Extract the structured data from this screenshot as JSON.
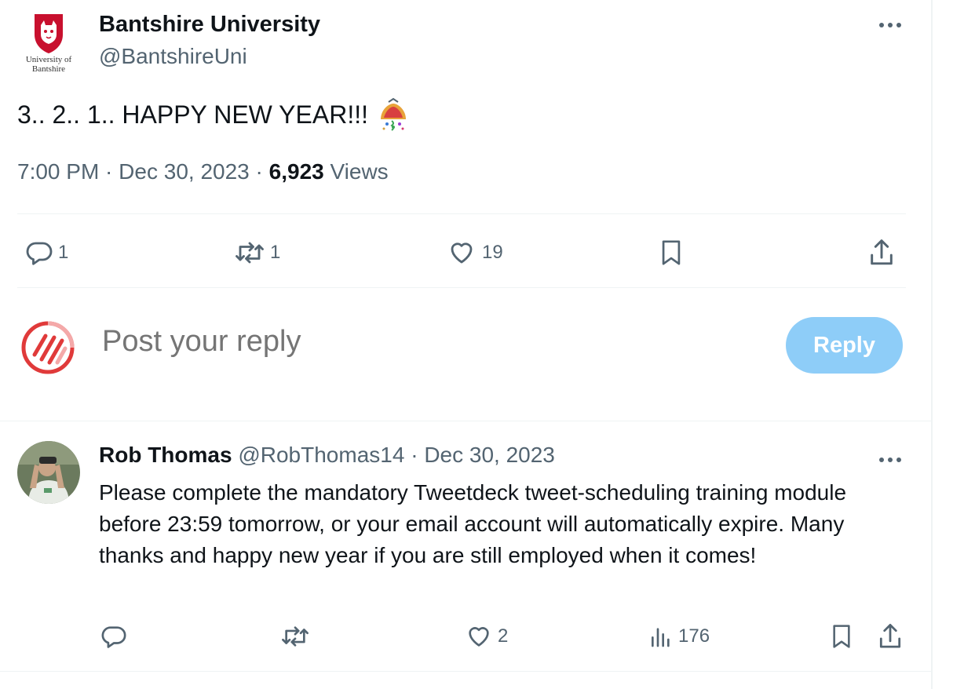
{
  "main_tweet": {
    "avatar_text_line1": "University of",
    "avatar_text_line2": "Bantshire",
    "display_name": "Bantshire University",
    "handle": "@BantshireUni",
    "text": "3.. 2.. 1.. HAPPY NEW YEAR!!!",
    "emoji_icon": "party-popper-icon",
    "time": "7:00 PM",
    "separator": " · ",
    "date": "Dec 30, 2023",
    "views_count": "6,923",
    "views_label": "Views",
    "actions": {
      "replies": "1",
      "reposts": "1",
      "likes": "19"
    }
  },
  "reply_composer": {
    "placeholder": "Post your reply",
    "button_label": "Reply",
    "button_color": "#8ecdf8"
  },
  "reply_tweet": {
    "display_name": "Rob Thomas",
    "handle": "@RobThomas14",
    "separator": " · ",
    "date": "Dec 30, 2023",
    "text": "Please complete the mandatory Tweetdeck tweet-scheduling training module before 23:59 tomorrow, or your email account will automatically expire. Many thanks and happy new year if you are still employed when it comes!",
    "actions": {
      "replies": "",
      "reposts": "",
      "likes": "2",
      "views": "176"
    }
  },
  "colors": {
    "text": "#0f1419",
    "muted": "#536471",
    "divider": "#eff3f4",
    "brand_red": "#c8102e"
  }
}
